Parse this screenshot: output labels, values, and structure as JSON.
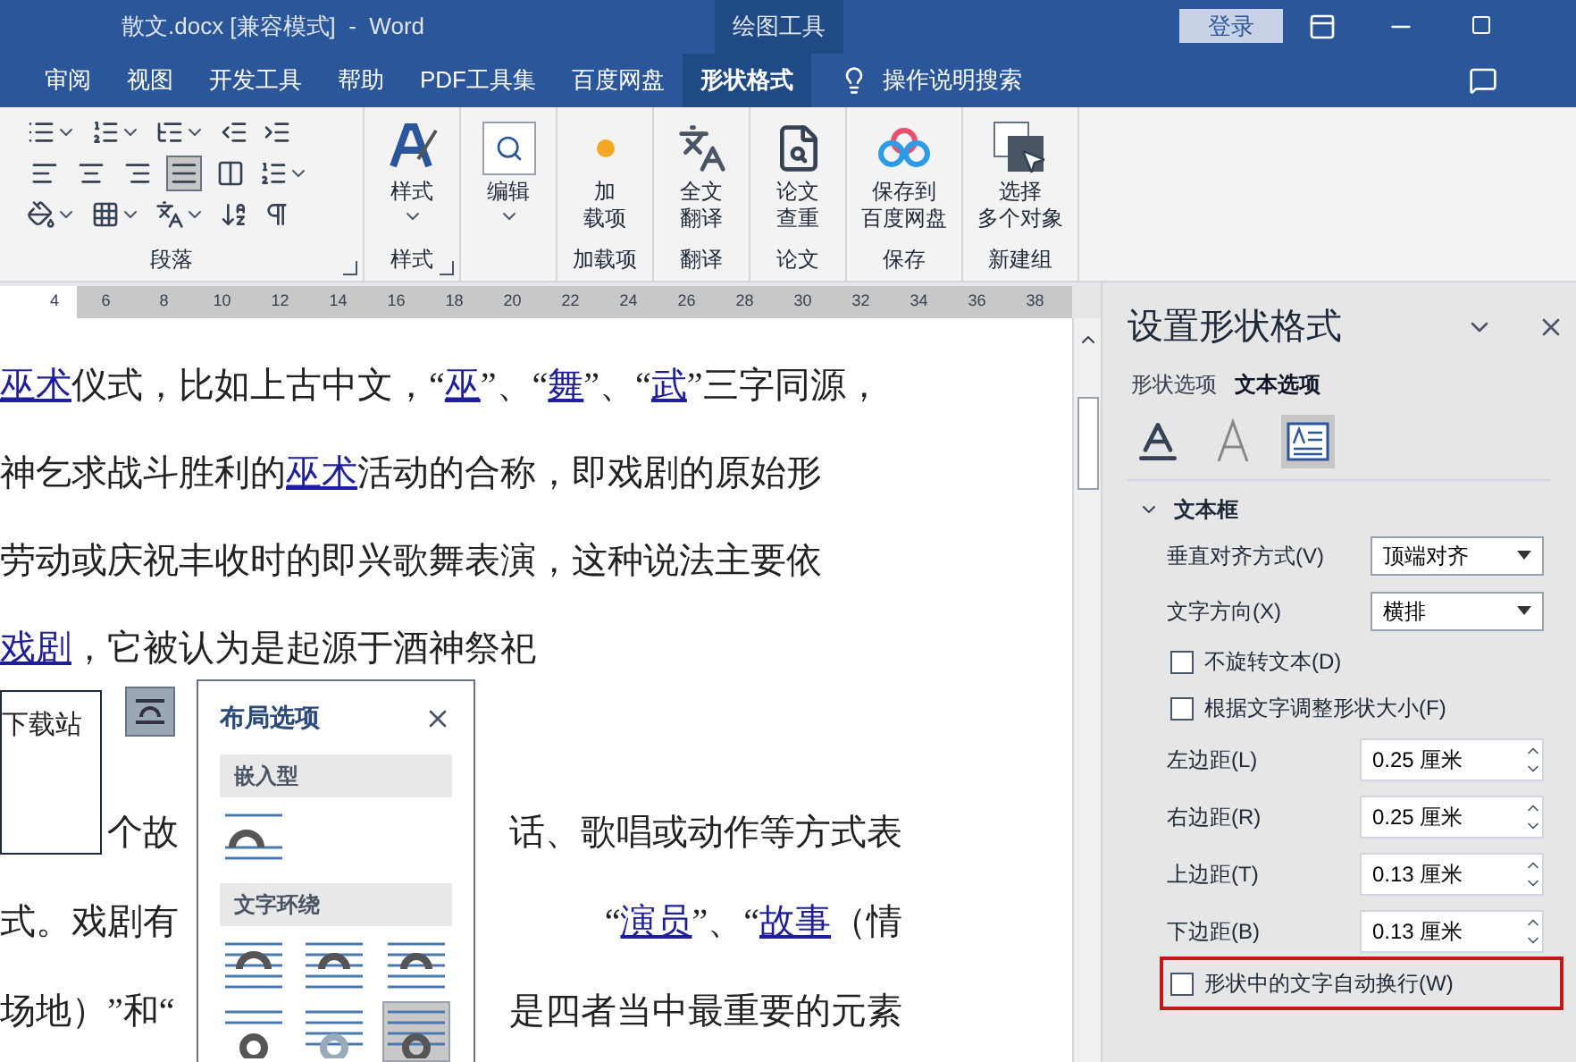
{
  "window": {
    "title": "散文.docx [兼容模式]  -  Word",
    "context_label": "绘图工具",
    "login": "登录"
  },
  "tabs": [
    {
      "label": "审阅",
      "selected": false
    },
    {
      "label": "视图",
      "selected": false
    },
    {
      "label": "开发工具",
      "selected": false
    },
    {
      "label": "帮助",
      "selected": false
    },
    {
      "label": "PDF工具集",
      "selected": false
    },
    {
      "label": "百度网盘",
      "selected": false
    },
    {
      "label": "形状格式",
      "selected": true
    }
  ],
  "tell_me": "操作说明搜索",
  "ribbon": {
    "paragraph": {
      "label": "段落",
      "alignment": [
        {
          "kind": "left",
          "selected": false
        },
        {
          "kind": "center",
          "selected": false
        },
        {
          "kind": "right",
          "selected": false
        },
        {
          "kind": "justify",
          "selected": true
        },
        {
          "kind": "distributed",
          "selected": false
        }
      ]
    },
    "groups": [
      {
        "label": "样式",
        "launcher": true,
        "buttons": [
          {
            "lines": [
              "样式"
            ],
            "dropdown": true
          }
        ]
      },
      {
        "buttons": [
          {
            "lines": [
              "编辑"
            ],
            "dropdown": true
          }
        ]
      },
      {
        "label": "加载项",
        "buttons": [
          {
            "lines": [
              "加",
              "载项"
            ]
          }
        ]
      },
      {
        "label": "翻译",
        "buttons": [
          {
            "lines": [
              "全文",
              "翻译"
            ]
          }
        ]
      },
      {
        "label": "论文",
        "buttons": [
          {
            "lines": [
              "论文",
              "查重"
            ]
          }
        ]
      },
      {
        "label": "保存",
        "buttons": [
          {
            "lines": [
              "保存到",
              "百度网盘"
            ]
          }
        ]
      },
      {
        "label": "新建组",
        "buttons": [
          {
            "lines": [
              "选择",
              "多个对象"
            ]
          }
        ]
      }
    ]
  },
  "ruler": {
    "numbers": [
      "4",
      "6",
      "8",
      "10",
      "12",
      "14",
      "16",
      "18",
      "20",
      "22",
      "24",
      "26",
      "28",
      "30",
      "32",
      "34",
      "36",
      "38"
    ]
  },
  "document": {
    "lines": [
      {
        "kind": "full",
        "left": [
          {
            "text": "巫术",
            "link": true
          },
          {
            "text": "仪式，比如上古中文，“",
            "link": false
          },
          {
            "text": "巫",
            "link": true
          },
          {
            "text": "”、“",
            "link": false
          },
          {
            "text": "舞",
            "link": true
          },
          {
            "text": "”、“",
            "link": false
          },
          {
            "text": "武",
            "link": true
          },
          {
            "text": "”三字同源，",
            "link": false
          }
        ]
      },
      {
        "kind": "full",
        "left": [
          {
            "text": "神乞求战斗胜利的",
            "link": false
          },
          {
            "text": "巫术",
            "link": true
          },
          {
            "text": "活动的合称，即戏剧的原始形",
            "link": false
          }
        ]
      },
      {
        "kind": "full",
        "left": [
          {
            "text": "劳动或庆祝丰收时的即兴歌舞表演，这种说法主要依",
            "link": false
          }
        ]
      },
      {
        "kind": "full",
        "left": [
          {
            "text": "戏剧",
            "link": true
          },
          {
            "text": "，它被认为是起源于酒神祭祀",
            "link": false
          }
        ]
      },
      {
        "kind": "gap"
      },
      {
        "kind": "beside_shape",
        "left": [
          {
            "text": "个故",
            "link": false
          }
        ],
        "right": [
          {
            "text": "话、歌唱或动作等方式表",
            "link": false
          }
        ]
      },
      {
        "kind": "split",
        "left": [
          {
            "text": "式。戏剧有",
            "link": false
          }
        ],
        "right": [
          {
            "text": "“",
            "link": false
          },
          {
            "text": "演员",
            "link": true
          },
          {
            "text": "”、“",
            "link": false
          },
          {
            "text": "故事",
            "link": true
          },
          {
            "text": "（情",
            "link": false
          }
        ]
      },
      {
        "kind": "split",
        "left": [
          {
            "text": "场地）”和“",
            "link": false
          }
        ],
        "right": [
          {
            "text": "是四者当中最重要的元素",
            "link": false
          }
        ]
      }
    ],
    "shape_text": "下载站"
  },
  "layout_popup": {
    "title": "布局选项",
    "sections": [
      {
        "label": "嵌入型",
        "options": [
          {
            "kind": "inline",
            "selected": false
          }
        ]
      },
      {
        "label": "文字环绕",
        "options": [
          {
            "kind": "square",
            "selected": false
          },
          {
            "kind": "tight",
            "selected": false
          },
          {
            "kind": "through",
            "selected": false
          },
          {
            "kind": "top_bottom",
            "selected": false
          },
          {
            "kind": "behind",
            "selected": false
          },
          {
            "kind": "front",
            "selected": true
          }
        ]
      }
    ]
  },
  "pane": {
    "title": "设置形状格式",
    "tabs": [
      {
        "label": "形状选项",
        "selected": false
      },
      {
        "label": "文本选项",
        "selected": true
      }
    ],
    "icon_tabs": [
      {
        "kind": "fill",
        "selected": false
      },
      {
        "kind": "outline",
        "selected": false
      },
      {
        "kind": "textbox",
        "selected": true
      }
    ],
    "section": {
      "label": "文本框",
      "expanded": true,
      "rows": [
        {
          "kind": "select",
          "label": "垂直对齐方式(V)",
          "value": "顶端对齐"
        },
        {
          "kind": "select",
          "label": "文字方向(X)",
          "value": "横排"
        },
        {
          "kind": "checkbox",
          "label": "不旋转文本(D)",
          "checked": false,
          "highlighted": false
        },
        {
          "kind": "checkbox",
          "label": "根据文字调整形状大小(F)",
          "checked": false,
          "highlighted": false
        },
        {
          "kind": "spinner",
          "label": "左边距(L)",
          "value": "0.25 厘米"
        },
        {
          "kind": "spinner",
          "label": "右边距(R)",
          "value": "0.25 厘米"
        },
        {
          "kind": "spinner",
          "label": "上边距(T)",
          "value": "0.13 厘米"
        },
        {
          "kind": "spinner",
          "label": "下边距(B)",
          "value": "0.13 厘米"
        },
        {
          "kind": "checkbox",
          "label": "形状中的文字自动换行(W)",
          "checked": false,
          "highlighted": true
        }
      ]
    }
  }
}
